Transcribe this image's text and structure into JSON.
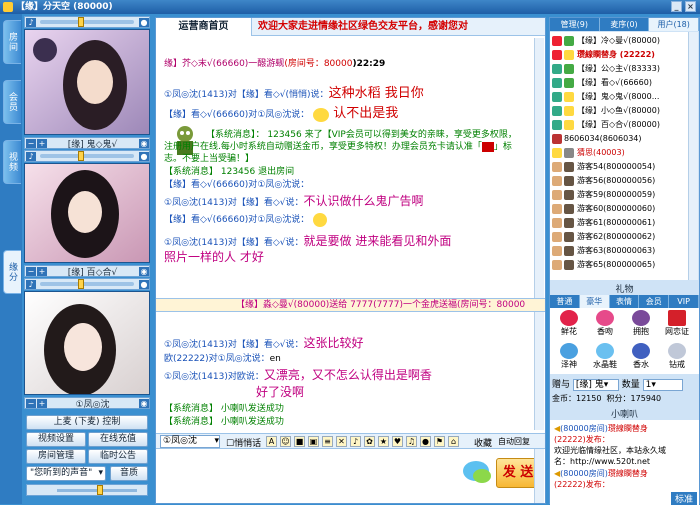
{
  "window": {
    "title": "【缘】分天空 (80000)"
  },
  "left_tabs": [
    "房",
    "间",
    "会",
    "员",
    "视",
    "频",
    "缘",
    "分"
  ],
  "videos": [
    {
      "name": "[缘] 鬼◇鬼√"
    },
    {
      "name": "[缘] 百◇合√"
    },
    {
      "name": "①凤◎沈"
    }
  ],
  "controls": {
    "mic_button": "上麦 (下麦) 控制",
    "video_settings": "视频设置",
    "online_recharge": "在线充值",
    "room_manage": "房间管理",
    "temp_notice": "临时公告",
    "sound_select": "\"您听到的声音\"",
    "sound_effect": "音质"
  },
  "main_tab": "运营商首页",
  "marquee": "欢迎大家走进情缘社区绿色交友平台，感谢您对",
  "room_header": {
    "user": "缘】芥◇末√(66660)一醱游觋",
    "room_label": "(房间号：",
    "room_no": "80000",
    "time": ")22:29"
  },
  "chat1": [
    {
      "from": "①凤◎沈(1413)对",
      "target": "【缘】看◇√",
      "say": "(悄悄)说：",
      "text": "这种水稻 我日你"
    },
    {
      "from": "【缘】看◇√(66660)对",
      "target": "①凤◎沈",
      "say": "说：",
      "text": "认不出是我"
    },
    {
      "sys": "【系统消息】： 123456 来了【VIP会员可以得到美女的亲睐，享受更多权限，"
    },
    {
      "sys": "注册用户在线.每小时系统自动赠送金币，享受更多特权！办理会员充卡请认准「",
      "tail": "」标"
    },
    {
      "sys": "志。不要上当受骗！】"
    },
    {
      "sys": "【系统消息】 123456 退出房间"
    },
    {
      "from": "【缘】看◇√(66660)对",
      "target": "①凤◎沈",
      "say": "说：",
      "text": ""
    },
    {
      "from": "①凤◎沈(1413)对",
      "target": "【缘】看◇√",
      "say": "说：",
      "text": "不认识做什么鬼广告啊"
    },
    {
      "from": "【缘】看◇√(66660)对",
      "target": "①凤◎沈",
      "say": "说：",
      "text": ""
    },
    {
      "from": "①凤◎沈(1413)对",
      "target": "【缘】看◇√",
      "say": "说：",
      "text": "就是要做 进来能看见和外面"
    },
    {
      "cont": "照片一样的人 才好"
    }
  ],
  "gift_bar": "【缘】淼◇曼√(80000)送给 7777(7777)一个金虎送福(房间号：80000",
  "chat2": [
    {
      "from": "①凤◎沈(1413)对",
      "target": "【缘】看◇√",
      "say": "说：",
      "text": "这张比较好"
    },
    {
      "from": "欧(22222)对",
      "target": "①凤◎沈",
      "say": "说：",
      "text": "en"
    },
    {
      "from": "①凤◎沈(1413)对",
      "target": "欧",
      "say": "说：",
      "text": "又漂亮，又不怎么认得出是啊香"
    },
    {
      "cont": "好了没啊"
    },
    {
      "sys": "【系统消息】 小喇叭发送成功"
    },
    {
      "sys": "【系统消息】 小喇叭发送成功"
    }
  ],
  "toolbar": {
    "target": "①凤◎沈",
    "whisper": "悄悄话",
    "font": "A",
    "collect": "收藏",
    "auto_reply": "自动回复"
  },
  "send_button": "发 送",
  "right_tabs": [
    "管理(9)",
    "麦序(0)",
    "用户(18)"
  ],
  "users": [
    {
      "name": "【缘】冷◇曼√(80000)"
    },
    {
      "name": "瓒線瞷替身 (22222)"
    },
    {
      "name": "【缘】公◇主√(83333)"
    },
    {
      "name": "【缘】看◇√(66660)"
    },
    {
      "name": "【缘】鬼◇鬼√(8000..."
    },
    {
      "name": "【缘】小◇鱼√(80000)"
    },
    {
      "name": "【缘】百◇合√(80000)"
    },
    {
      "name": "8606034(8606034)"
    },
    {
      "name": "猜思(40003)"
    },
    {
      "name": "游客54(800000054)"
    },
    {
      "name": "游客56(800000056)"
    },
    {
      "name": "游客59(800000059)"
    },
    {
      "name": "游客60(800000060)"
    },
    {
      "name": "游客61(800000061)"
    },
    {
      "name": "游客62(800000062)"
    },
    {
      "name": "游客63(800000063)"
    },
    {
      "name": "游客65(800000065)"
    }
  ],
  "gifts_title": "礼物",
  "gift_tabs": [
    "普通",
    "豪华",
    "表情",
    "会员",
    "VIP"
  ],
  "gifts": [
    "鲜花",
    "香吻",
    "拥抱",
    "网恋证",
    "泽神",
    "水晶鞋",
    "香水",
    "钻戒"
  ],
  "gift_send": {
    "label": "赠与",
    "target": "[缘] 鬼",
    "count_label": "数量",
    "count": "1"
  },
  "wallet": {
    "gold_label": "金币：",
    "gold": "12150",
    "points_label": "积分：",
    "points": "175940"
  },
  "announce_title": "小喇叭",
  "announce": [
    {
      "room": "(80000房间)",
      "user": "瓒線瞷替身",
      "tail": ""
    },
    {
      "room": "(22222)发布：",
      "user": "",
      "tail": ""
    },
    {
      "room": "欢迎光临情缘社区，本站永久域",
      "user": "",
      "tail": ""
    },
    {
      "room": "名：http://www.520t.net",
      "user": "",
      "tail": ""
    },
    {
      "room": "(80000房间)",
      "user": "瓒線瞷替身",
      "tail": ""
    },
    {
      "room": "(22222)发布：",
      "user": "",
      "tail": ""
    }
  ],
  "bottom_status": "标准"
}
